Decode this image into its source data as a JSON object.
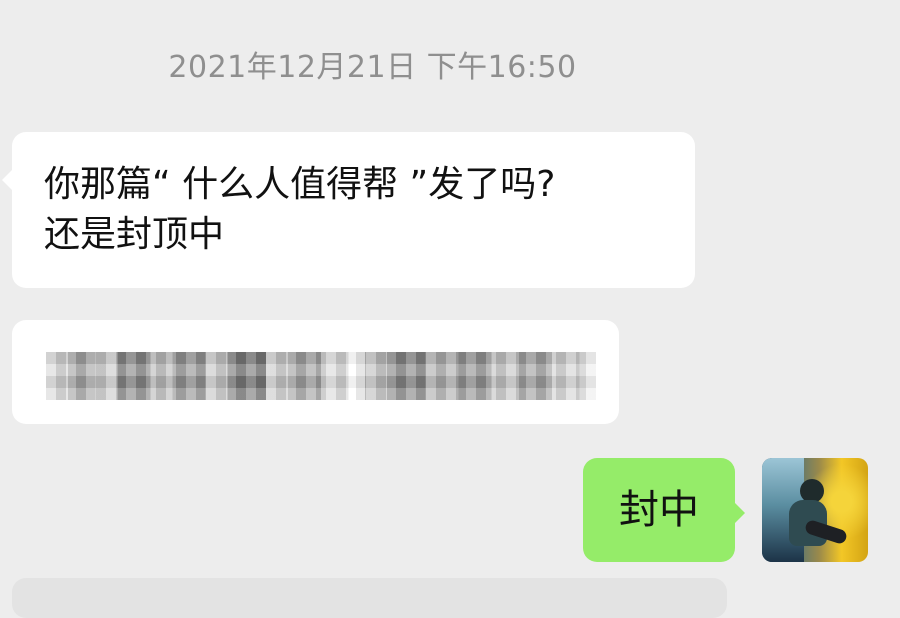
{
  "chat": {
    "timestamp": "2021年12月21日 下午16:50",
    "messages": [
      {
        "side": "incoming",
        "lines": [
          "你那篇“ 什么人值得帮 ”发了吗?",
          "还是封顶中"
        ]
      },
      {
        "side": "incoming",
        "content": "blurred-message"
      },
      {
        "side": "outgoing",
        "text": "封中"
      }
    ]
  },
  "colors": {
    "background": "#ededed",
    "incoming_bubble": "#ffffff",
    "outgoing_bubble": "#95ec69",
    "timestamp_text": "#8f8f8f",
    "message_text": "#111111"
  },
  "icons": {
    "avatar": "user-avatar-image"
  }
}
